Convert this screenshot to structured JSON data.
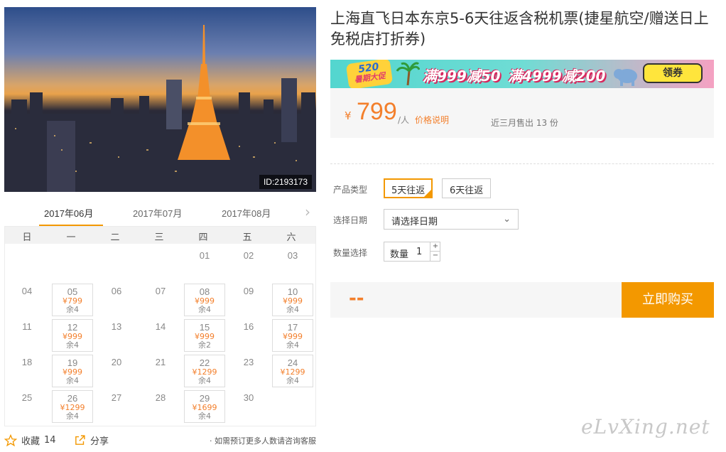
{
  "product": {
    "title": "上海直飞日本东京5-6天往返含税机票(捷星航空/赠送日上免税店打折券)",
    "image_id": "ID:2193173"
  },
  "calendar": {
    "months": [
      "2017年06月",
      "2017年07月",
      "2017年08月"
    ],
    "weekdays": [
      "日",
      "一",
      "二",
      "三",
      "四",
      "五",
      "六"
    ],
    "days": [
      {
        "d": "01"
      },
      {
        "d": "02"
      },
      {
        "d": "03"
      },
      {
        "d": "04"
      },
      {
        "d": "05",
        "price": "¥799",
        "stock": "余4"
      },
      {
        "d": "06"
      },
      {
        "d": "07"
      },
      {
        "d": "08",
        "price": "¥999",
        "stock": "余4"
      },
      {
        "d": "09"
      },
      {
        "d": "10",
        "price": "¥999",
        "stock": "余4"
      },
      {
        "d": "11"
      },
      {
        "d": "12",
        "price": "¥999",
        "stock": "余4"
      },
      {
        "d": "13"
      },
      {
        "d": "14"
      },
      {
        "d": "15",
        "price": "¥999",
        "stock": "余2"
      },
      {
        "d": "16"
      },
      {
        "d": "17",
        "price": "¥999",
        "stock": "余4"
      },
      {
        "d": "18"
      },
      {
        "d": "19",
        "price": "¥999",
        "stock": "余4"
      },
      {
        "d": "20"
      },
      {
        "d": "21"
      },
      {
        "d": "22",
        "price": "¥1299",
        "stock": "余4"
      },
      {
        "d": "23"
      },
      {
        "d": "24",
        "price": "¥1299",
        "stock": "余4"
      },
      {
        "d": "25"
      },
      {
        "d": "26",
        "price": "¥1299",
        "stock": "余4"
      },
      {
        "d": "27"
      },
      {
        "d": "28"
      },
      {
        "d": "29",
        "price": "¥1699",
        "stock": "余4"
      },
      {
        "d": "30"
      }
    ]
  },
  "footer": {
    "favorite_label": "收藏",
    "favorite_count": "14",
    "share_label": "分享",
    "consult_note": "· 如需预订更多人数请咨询客服"
  },
  "promo": {
    "badge_top": "520",
    "badge_bottom": "暑期大促",
    "offer1": "满999减50",
    "offer2": "满4999减200",
    "button": "领券"
  },
  "price": {
    "currency": "¥",
    "value": "799",
    "unit": "/人",
    "note": "价格说明",
    "sold": "近三月售出 13 份"
  },
  "options": {
    "type_label": "产品类型",
    "types": [
      "5天往返",
      "6天往返"
    ],
    "date_label": "选择日期",
    "date_placeholder": "请选择日期",
    "qty_label": "数量选择",
    "qty_inner_label": "数量",
    "qty_value": "1",
    "qty_plus": "+",
    "qty_minus": "−"
  },
  "buy": {
    "total": "--",
    "button": "立即购买"
  },
  "watermark": "eLvXing.net",
  "colors": {
    "accent": "#f39800",
    "price": "#f37f2b"
  }
}
